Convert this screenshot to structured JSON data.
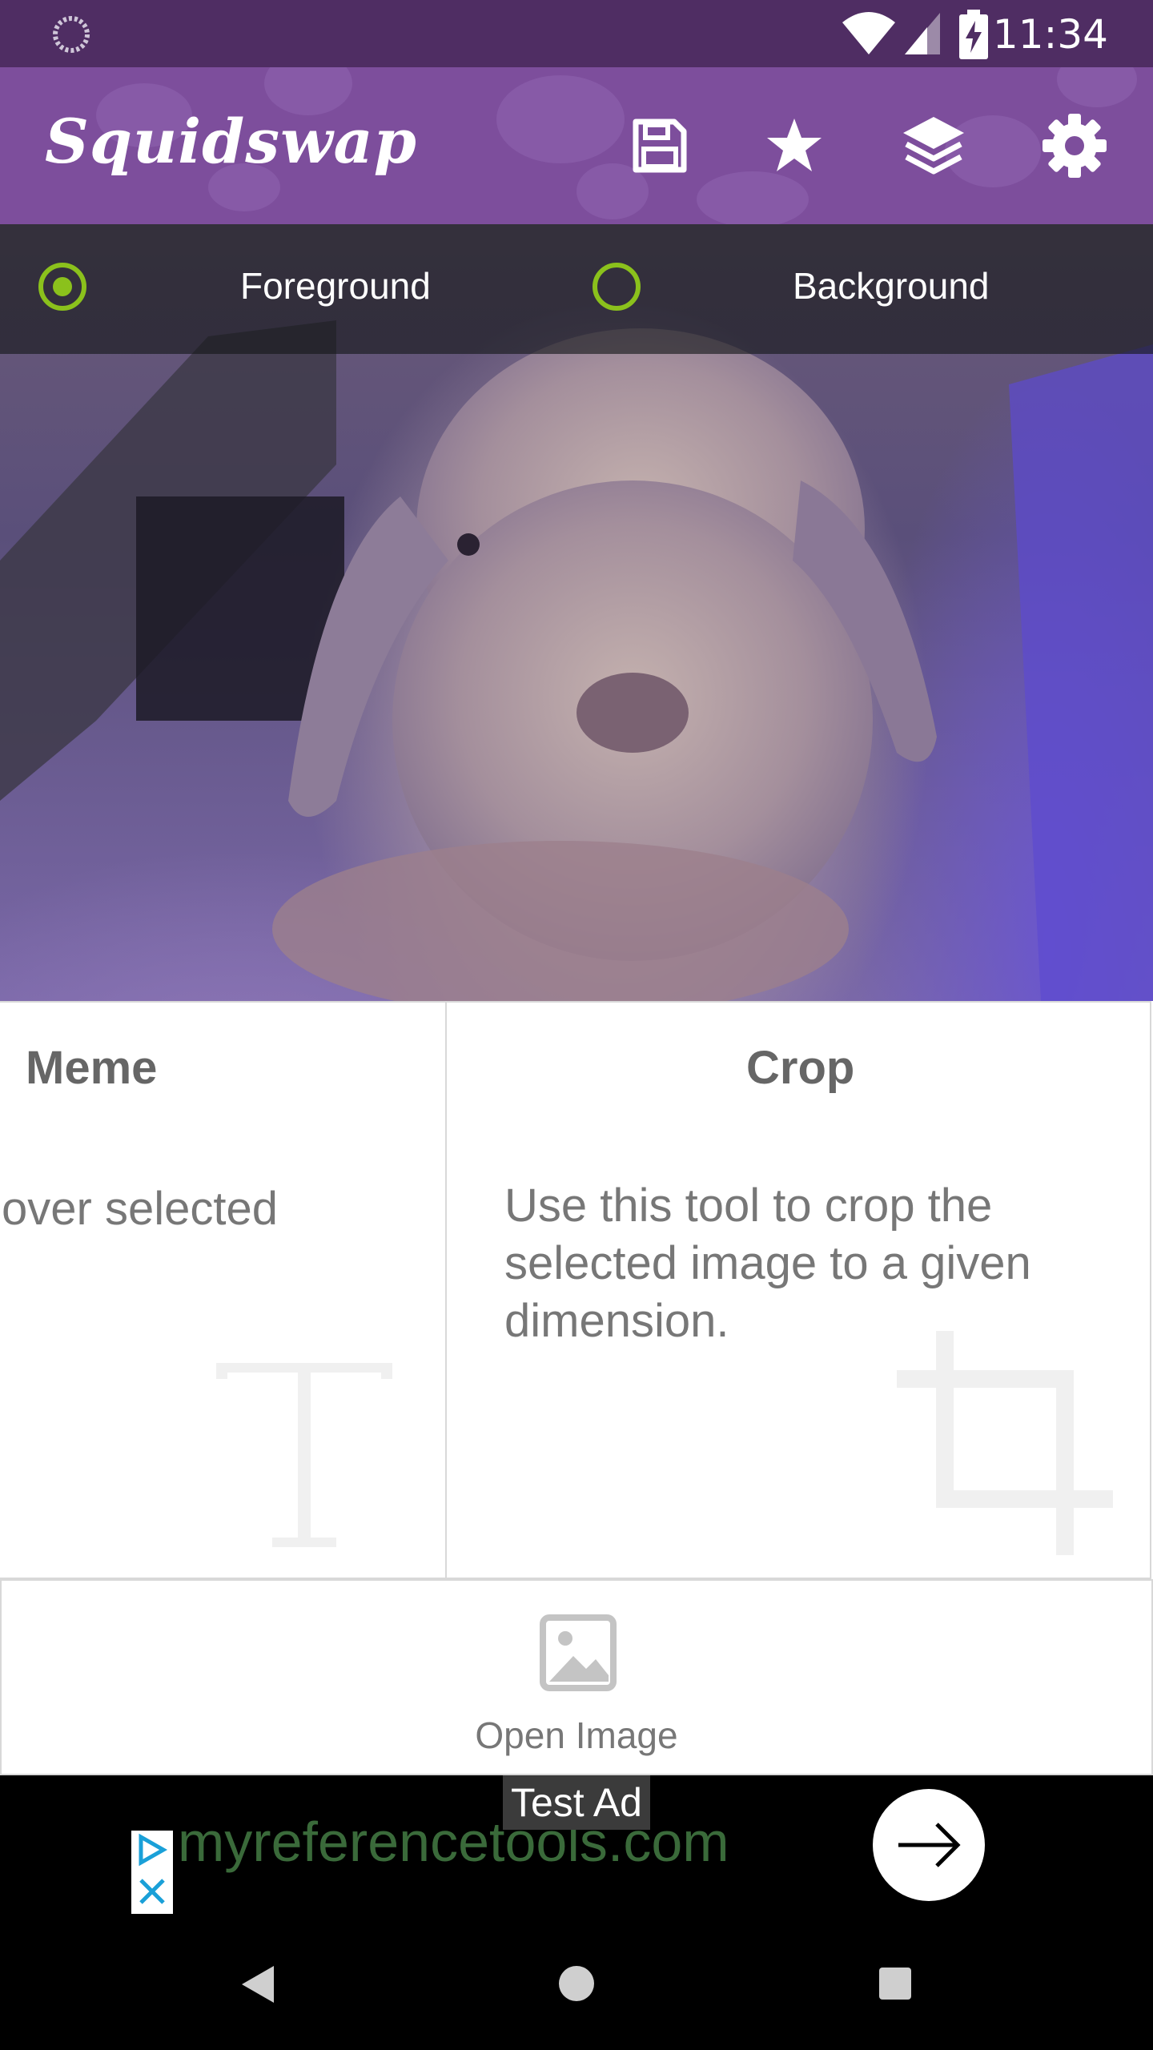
{
  "status_bar": {
    "time": "11:34"
  },
  "app_bar": {
    "title": "Squidswap",
    "actions": [
      "save-icon",
      "star-icon",
      "layers-icon",
      "settings-icon"
    ]
  },
  "layer_selector": {
    "options": [
      {
        "label": "Foreground",
        "selected": true
      },
      {
        "label": "Background",
        "selected": false
      }
    ]
  },
  "cards": [
    {
      "title": "Meme",
      "description": "over selected",
      "icon": "text-icon"
    },
    {
      "title": "Crop",
      "description": "Use this tool to crop the selected image to a given dimension.",
      "icon": "crop-icon"
    }
  ],
  "open_image": {
    "label": "Open Image",
    "icon": "image-icon"
  },
  "ad": {
    "tag": "Test Ad",
    "url": "myreferencetools.com"
  },
  "colors": {
    "status_bar": "#4f2d63",
    "app_bar": "#7d4e9c",
    "radio_accent": "#8bc11c"
  }
}
